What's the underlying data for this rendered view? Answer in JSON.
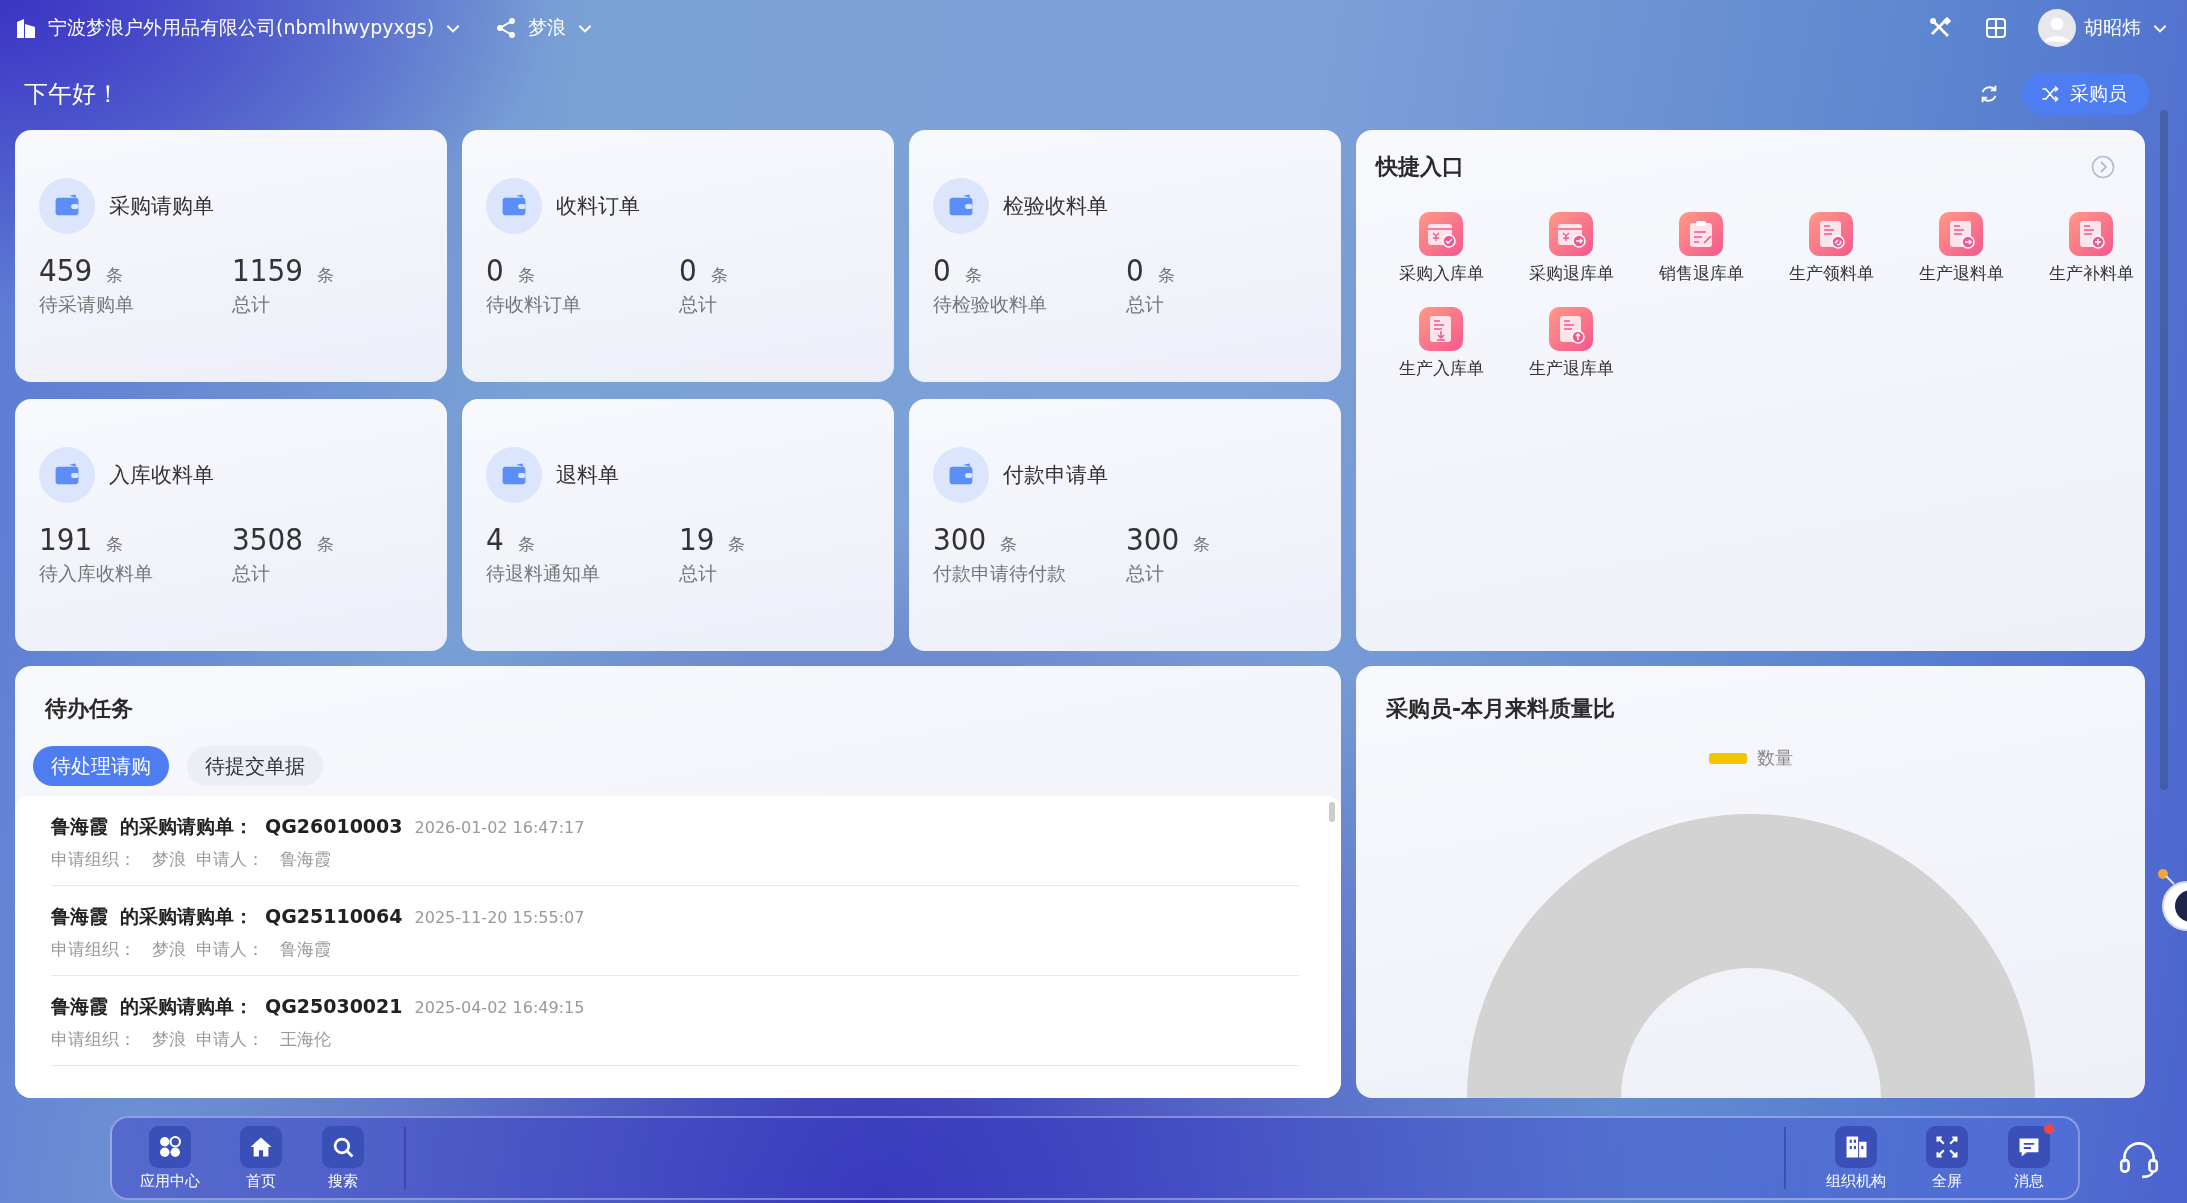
{
  "top_bar": {
    "company": "宁波梦浪户外用品有限公司(nbmlhwypyxgs)",
    "org": "梦浪",
    "user": "胡昭炜"
  },
  "greeting": "下午好！",
  "role_button": "采购员",
  "cards": [
    {
      "title": "采购请购单",
      "stats": [
        {
          "value": "459",
          "unit": "条",
          "label": "待采请购单"
        },
        {
          "value": "1159",
          "unit": "条",
          "label": "总计"
        }
      ]
    },
    {
      "title": "收料订单",
      "stats": [
        {
          "value": "0",
          "unit": "条",
          "label": "待收料订单"
        },
        {
          "value": "0",
          "unit": "条",
          "label": "总计"
        }
      ]
    },
    {
      "title": "检验收料单",
      "stats": [
        {
          "value": "0",
          "unit": "条",
          "label": "待检验收料单"
        },
        {
          "value": "0",
          "unit": "条",
          "label": "总计"
        }
      ]
    },
    {
      "title": "入库收料单",
      "stats": [
        {
          "value": "191",
          "unit": "条",
          "label": "待入库收料单"
        },
        {
          "value": "3508",
          "unit": "条",
          "label": "总计"
        }
      ]
    },
    {
      "title": "退料单",
      "stats": [
        {
          "value": "4",
          "unit": "条",
          "label": "待退料通知单"
        },
        {
          "value": "19",
          "unit": "条",
          "label": "总计"
        }
      ]
    },
    {
      "title": "付款申请单",
      "stats": [
        {
          "value": "300",
          "unit": "条",
          "label": "付款申请待付款"
        },
        {
          "value": "300",
          "unit": "条",
          "label": "总计"
        }
      ]
    }
  ],
  "quick_entry": {
    "title": "快捷入口",
    "items": [
      {
        "label": "采购入库单",
        "kind": "yen-check"
      },
      {
        "label": "采购退库单",
        "kind": "yen-arrow"
      },
      {
        "label": "销售退库单",
        "kind": "clipboard"
      },
      {
        "label": "生产领料单",
        "kind": "doc-link"
      },
      {
        "label": "生产退料单",
        "kind": "doc-arrow"
      },
      {
        "label": "生产补料单",
        "kind": "doc-plus"
      },
      {
        "label": "生产入库单",
        "kind": "doc-down"
      },
      {
        "label": "生产退库单",
        "kind": "doc-up"
      }
    ]
  },
  "todo": {
    "title": "待办任务",
    "tabs": [
      {
        "label": "待处理请购",
        "selected": true
      },
      {
        "label": "待提交单据",
        "selected": false
      }
    ],
    "rows": [
      {
        "person": "鲁海霞",
        "doc_type": "的采购请购单：",
        "code": "QG26010003",
        "time": "2026-01-02 16:47:17",
        "org_label": "申请组织：",
        "org": "梦浪",
        "applicant_label": "申请人：",
        "applicant": "鲁海霞"
      },
      {
        "person": "鲁海霞",
        "doc_type": "的采购请购单：",
        "code": "QG25110064",
        "time": "2025-11-20 15:55:07",
        "org_label": "申请组织：",
        "org": "梦浪",
        "applicant_label": "申请人：",
        "applicant": "鲁海霞"
      },
      {
        "person": "鲁海霞",
        "doc_type": "的采购请购单：",
        "code": "QG25030021",
        "time": "2025-04-02 16:49:15",
        "org_label": "申请组织：",
        "org": "梦浪",
        "applicant_label": "申请人：",
        "applicant": "王海伦"
      }
    ]
  },
  "quality_chart": {
    "title": "采购员-本月来料质量比",
    "legend": [
      {
        "name": "数量",
        "color": "#f5c400"
      }
    ]
  },
  "dock": {
    "left": [
      {
        "label": "应用中心",
        "kind": "apps"
      },
      {
        "label": "首页",
        "kind": "home"
      },
      {
        "label": "搜索",
        "kind": "search"
      }
    ],
    "right": [
      {
        "label": "组织机构",
        "kind": "building",
        "unread": false
      },
      {
        "label": "全屏",
        "kind": "fullscreen",
        "unread": false
      },
      {
        "label": "消息",
        "kind": "message",
        "unread": true
      }
    ]
  }
}
